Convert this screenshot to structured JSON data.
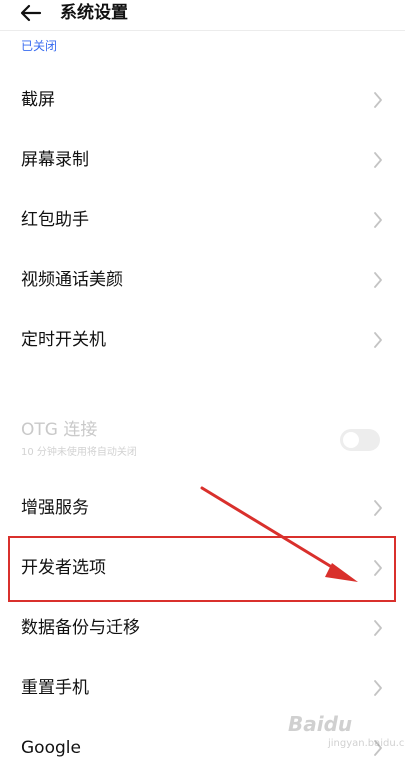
{
  "header": {
    "back_icon": "arrow-left-icon",
    "title": "系统设置"
  },
  "status_text": "已关闭",
  "settings_items": [
    {
      "label": "截屏"
    },
    {
      "label": "屏幕录制"
    },
    {
      "label": "红包助手"
    },
    {
      "label": "视频通话美颜"
    },
    {
      "label": "定时开关机"
    }
  ],
  "otg": {
    "title": "OTG 连接",
    "subtitle": "10 分钟未使用将自动关闭",
    "enabled": false
  },
  "settings_items_2": [
    {
      "label": "增强服务"
    },
    {
      "label": "开发者选项",
      "highlighted": true
    },
    {
      "label": "数据备份与迁移"
    },
    {
      "label": "重置手机"
    },
    {
      "label": "Google"
    }
  ],
  "annotation": {
    "highlight_color": "#d9302c"
  },
  "watermark": {
    "main": "Baidu",
    "sub": "jingyan.baidu.com"
  },
  "colors": {
    "accent": "#3a6df0",
    "chevron": "#c4c4c4"
  }
}
